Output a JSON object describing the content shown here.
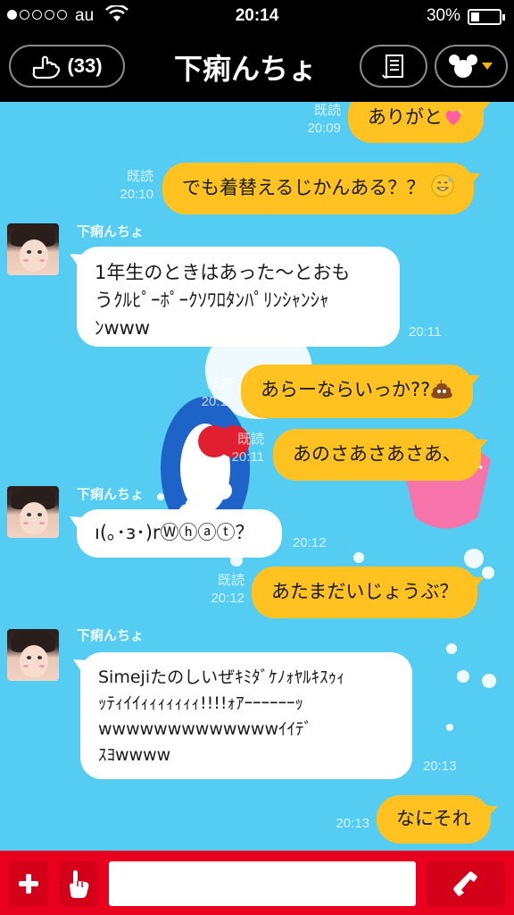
{
  "status_bar": {
    "carrier": "au",
    "time": "20:14",
    "battery_percent_text": "30%",
    "battery_level": 0.3,
    "signal_bars": 1
  },
  "header": {
    "back_count": "(33)",
    "title": "下痢んちょ",
    "back_icon": "hand-icon",
    "notes_icon": "scroll-icon",
    "theme_icon": "mickey-icon"
  },
  "messages": [
    {
      "direction": "out",
      "text": "ありがと",
      "emoji": "sparkling-heart",
      "read": "既読",
      "time": "20:09"
    },
    {
      "direction": "out",
      "text": "でも着替えるじかんある？？",
      "emoji": "sweat-smile",
      "read": "既読",
      "time": "20:10"
    },
    {
      "direction": "in",
      "sender": "下痢んちょ",
      "lines": [
        "1年生のときはあった〜とおも",
        "うｸﾙﾋﾟｰﾎﾟｰｸｿﾜﾛﾀﾝﾊﾟﾘﾝｼｬﾝｼｬ",
        "ﾝwww"
      ],
      "time": "20:11"
    },
    {
      "direction": "out",
      "text": "あらーならいっか??",
      "emoji": "poop",
      "read": "既読",
      "time": "20:11"
    },
    {
      "direction": "out",
      "text": "あのさあさあさあ、",
      "read": "既読",
      "time": "20:11"
    },
    {
      "direction": "in",
      "sender": "下痢んちょ",
      "lines": [
        "ı(｡･з･)rⓌⓗⓐⓣ？"
      ],
      "time": "20:12"
    },
    {
      "direction": "out",
      "text": "あたまだいじょうぶ？",
      "read": "既読",
      "time": "20:12"
    },
    {
      "direction": "in",
      "sender": "下痢んちょ",
      "lines": [
        "Simejiたのしいぜｷﾐﾀﾞｹﾉｫﾔﾙｷｽｩｨ",
        "ｯﾃｨｲｲｨｨｨｨｨｨｨ!!!!ｫｱｰｰｰｰｰｰｯ",
        "wwwwwwwwwwwwwｲｲﾃﾞ",
        "ｽﾖwwww"
      ],
      "time": "20:13"
    },
    {
      "direction": "out",
      "text": "なにそれ",
      "time": "20:13"
    }
  ],
  "input": {
    "value": "",
    "placeholder": ""
  },
  "bottom_bar": {
    "plus_icon": "plus-icon",
    "hand_icon": "pointing-hand-icon",
    "call_icon": "phone-icon"
  },
  "colors": {
    "chat_background": "#55ccf2",
    "outgoing_bubble": "#ffc220",
    "incoming_bubble": "#ffffff",
    "bottom_bar": "#e8001e"
  }
}
